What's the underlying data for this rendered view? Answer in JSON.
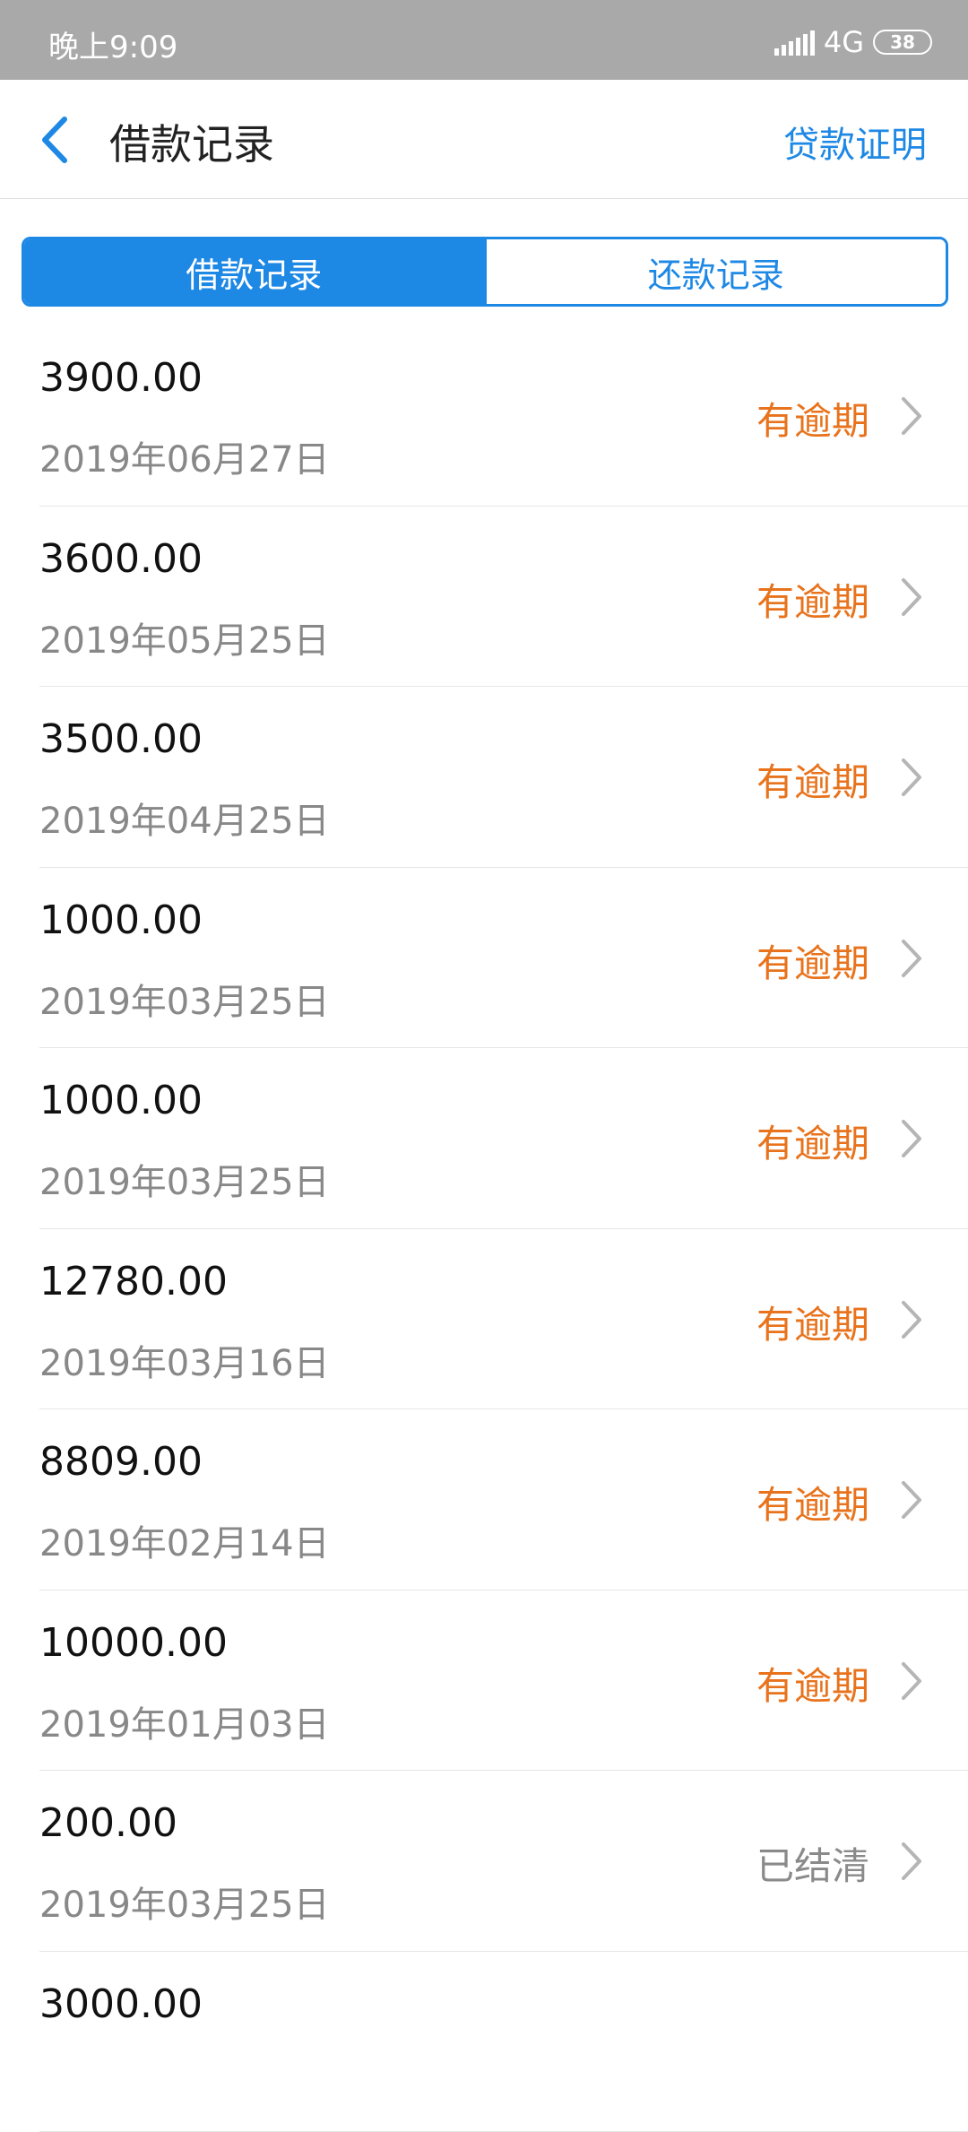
{
  "status_bar": {
    "time": "晚上9:09",
    "network": "4G",
    "battery": "38"
  },
  "nav": {
    "title": "借款记录",
    "action": "贷款证明"
  },
  "tabs": [
    {
      "label": "借款记录",
      "active": true
    },
    {
      "label": "还款记录",
      "active": false
    }
  ],
  "records": [
    {
      "amount": "3900.00",
      "date": "2019年06月27日",
      "status": "有逾期"
    },
    {
      "amount": "3600.00",
      "date": "2019年05月25日",
      "status": "有逾期"
    },
    {
      "amount": "3500.00",
      "date": "2019年04月25日",
      "status": "有逾期"
    },
    {
      "amount": "1000.00",
      "date": "2019年03月25日",
      "status": "有逾期"
    },
    {
      "amount": "1000.00",
      "date": "2019年03月25日",
      "status": "有逾期"
    },
    {
      "amount": "12780.00",
      "date": "2019年03月16日",
      "status": "有逾期"
    },
    {
      "amount": "8809.00",
      "date": "2019年02月14日",
      "status": "有逾期"
    },
    {
      "amount": "10000.00",
      "date": "2019年01月03日",
      "status": "有逾期"
    },
    {
      "amount": "200.00",
      "date": "2019年03月25日",
      "status": "已结清"
    },
    {
      "amount": "3000.00",
      "date": "",
      "status": ""
    }
  ],
  "colors": {
    "accent": "#1e88e5",
    "overdue": "#e8731c",
    "settled": "#8a8a8a"
  }
}
